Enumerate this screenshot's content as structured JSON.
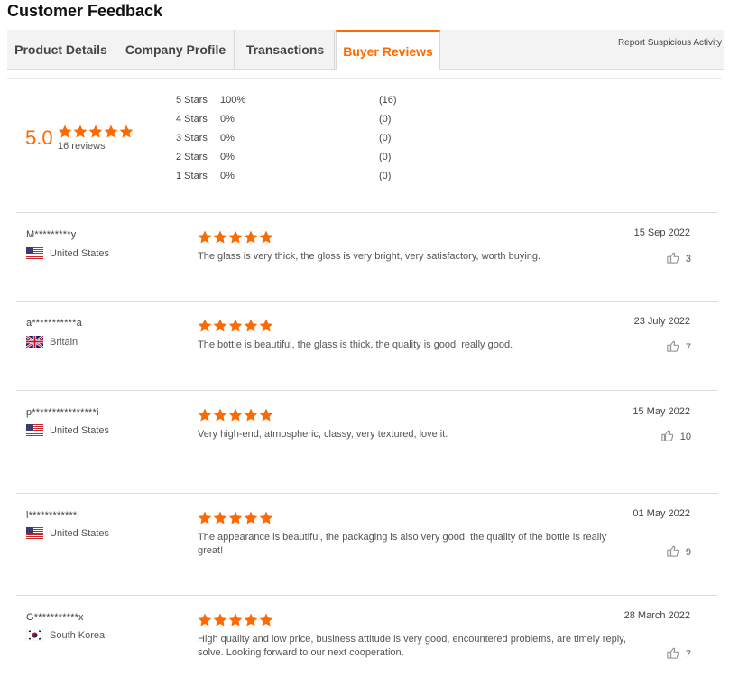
{
  "page_title": "Customer Feedback",
  "tabs": [
    {
      "label": "Product Details",
      "active": false
    },
    {
      "label": "Company Profile",
      "active": false
    },
    {
      "label": "Transactions",
      "active": false
    },
    {
      "label": "Buyer Reviews",
      "active": true
    }
  ],
  "report_link": "Report Suspicious Activity",
  "summary": {
    "average": "5.0",
    "average_stars": 5,
    "review_count": "16 reviews",
    "distribution": [
      {
        "label": "5 Stars",
        "percent": "100%",
        "count": "(16)"
      },
      {
        "label": "4 Stars",
        "percent": "0%",
        "count": "(0)"
      },
      {
        "label": "3 Stars",
        "percent": "0%",
        "count": "(0)"
      },
      {
        "label": "2 Stars",
        "percent": "0%",
        "count": "(0)"
      },
      {
        "label": "1 Stars",
        "percent": "0%",
        "count": "(0)"
      }
    ]
  },
  "reviews": [
    {
      "name": "M*********y",
      "country": "United States",
      "flag": "flag-us-icon",
      "stars": 5,
      "text": "The glass is very thick, the gloss is very bright, very satisfactory, worth buying.",
      "date": "15 Sep 2022",
      "helpful": "3"
    },
    {
      "name": "a***********a",
      "country": "Britain",
      "flag": "flag-uk-icon",
      "stars": 5,
      "text": "The bottle is beautiful, the glass is thick, the quality is good, really good.",
      "date": "23 July 2022",
      "helpful": "7"
    },
    {
      "name": "p****************i",
      "country": "United States",
      "flag": "flag-us-icon",
      "stars": 5,
      "text": "Very high-end, atmospheric, classy, very textured, love it.",
      "date": "15 May 2022",
      "helpful": "10"
    },
    {
      "name": "l************l",
      "country": "United States",
      "flag": "flag-us-icon",
      "stars": 5,
      "text": "The appearance is beautiful, the packaging is also very good, the quality of the bottle is really great!",
      "date": "01 May 2022",
      "helpful": "9"
    },
    {
      "name": "G***********x",
      "country": "South Korea",
      "flag": "flag-kr-icon",
      "stars": 5,
      "text": "High quality and low price, business attitude is very good, encountered problems, are timely reply, solve. Looking forward to our next cooperation.",
      "date": "28 March 2022",
      "helpful": "7"
    }
  ],
  "colors": {
    "accent": "#ff6a00",
    "star": "#ff6a00"
  }
}
